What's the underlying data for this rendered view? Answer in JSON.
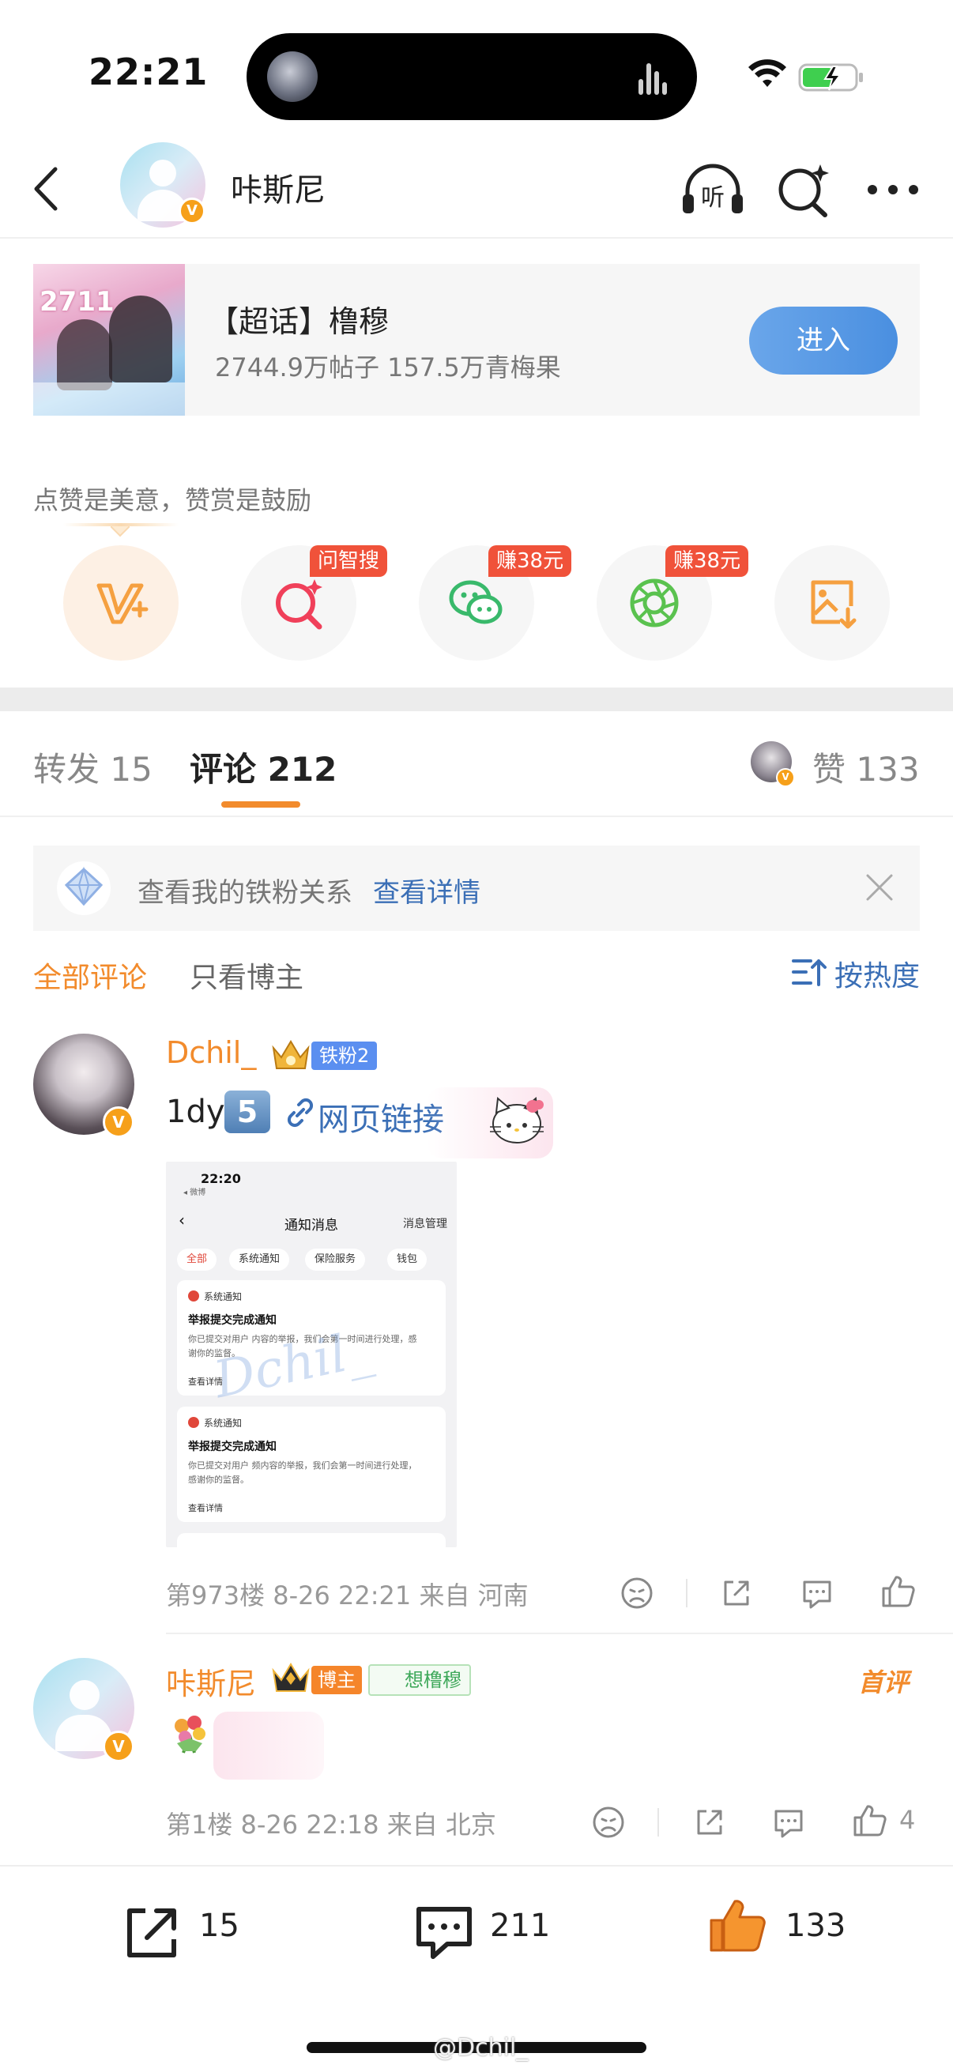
{
  "status_bar": {
    "time": "22:21"
  },
  "header": {
    "title": "咔斯尼"
  },
  "super_topic": {
    "name": "【超话】橹穆",
    "stats": "2744.9万帖子 157.5万青梅果",
    "enter_label": "进入",
    "cover_text": "2711"
  },
  "reward": {
    "text": "点赞是美意，赞赏是鼓励",
    "actions": [
      {
        "icon": "vplus-icon",
        "tag": ""
      },
      {
        "icon": "ai-search-icon",
        "tag": "问智搜"
      },
      {
        "icon": "wechat-icon",
        "tag": "赚38元"
      },
      {
        "icon": "moments-icon",
        "tag": "赚38元"
      },
      {
        "icon": "save-image-icon",
        "tag": ""
      }
    ]
  },
  "tabs": {
    "repost_label": "转发",
    "repost_count": "15",
    "comment_label": "评论",
    "comment_count": "212",
    "like_label": "赞",
    "like_count": "133"
  },
  "fan_banner": {
    "text": "查看我的铁粉关系",
    "link": "查看详情"
  },
  "filters": {
    "all": "全部评论",
    "blogger_only": "只看博主",
    "sort": "按热度"
  },
  "comments": [
    {
      "name": "Dchil_",
      "badge": "铁粉2",
      "text_prefix": "1dy",
      "key_emoji": "5",
      "link_text": "网页链接",
      "screenshot": {
        "time": "22:20",
        "sub": "◂ 微博",
        "title": "通知消息",
        "manage": "消息管理",
        "chips": [
          "全部",
          "系统通知",
          "保险服务",
          "钱包"
        ],
        "cards": [
          {
            "head": "系统通知",
            "title": "举报提交完成通知",
            "body": "你已提交对用户                 内容的举报，我们会第一时间进行处理，感谢你的监督。",
            "more": "查看详情"
          },
          {
            "head": "系统通知",
            "title": "举报提交完成通知",
            "body": "你已提交对用户                 频内容的举报，我们会第一时间进行处理，感谢你的监督。",
            "more": "查看详情"
          }
        ],
        "watermark": "Dchil_"
      },
      "meta": "第973楼 8-26 22:21 来自 河南",
      "like_count": ""
    },
    {
      "name": "咔斯尼",
      "badge": "博主",
      "want_badge": "想橹穆",
      "first_label": "首评",
      "meta": "第1楼 8-26 22:18 来自 北京",
      "like_count": "4"
    }
  ],
  "bottom_bar": {
    "repost_count": "15",
    "comment_count": "211",
    "like_count": "133"
  },
  "watermark": "@Dchil_",
  "colors": {
    "accent_orange": "#f28b2c",
    "link_blue": "#3b6fb6",
    "enter_button": "#4a8fe0",
    "tag_red": "#f0523a"
  }
}
